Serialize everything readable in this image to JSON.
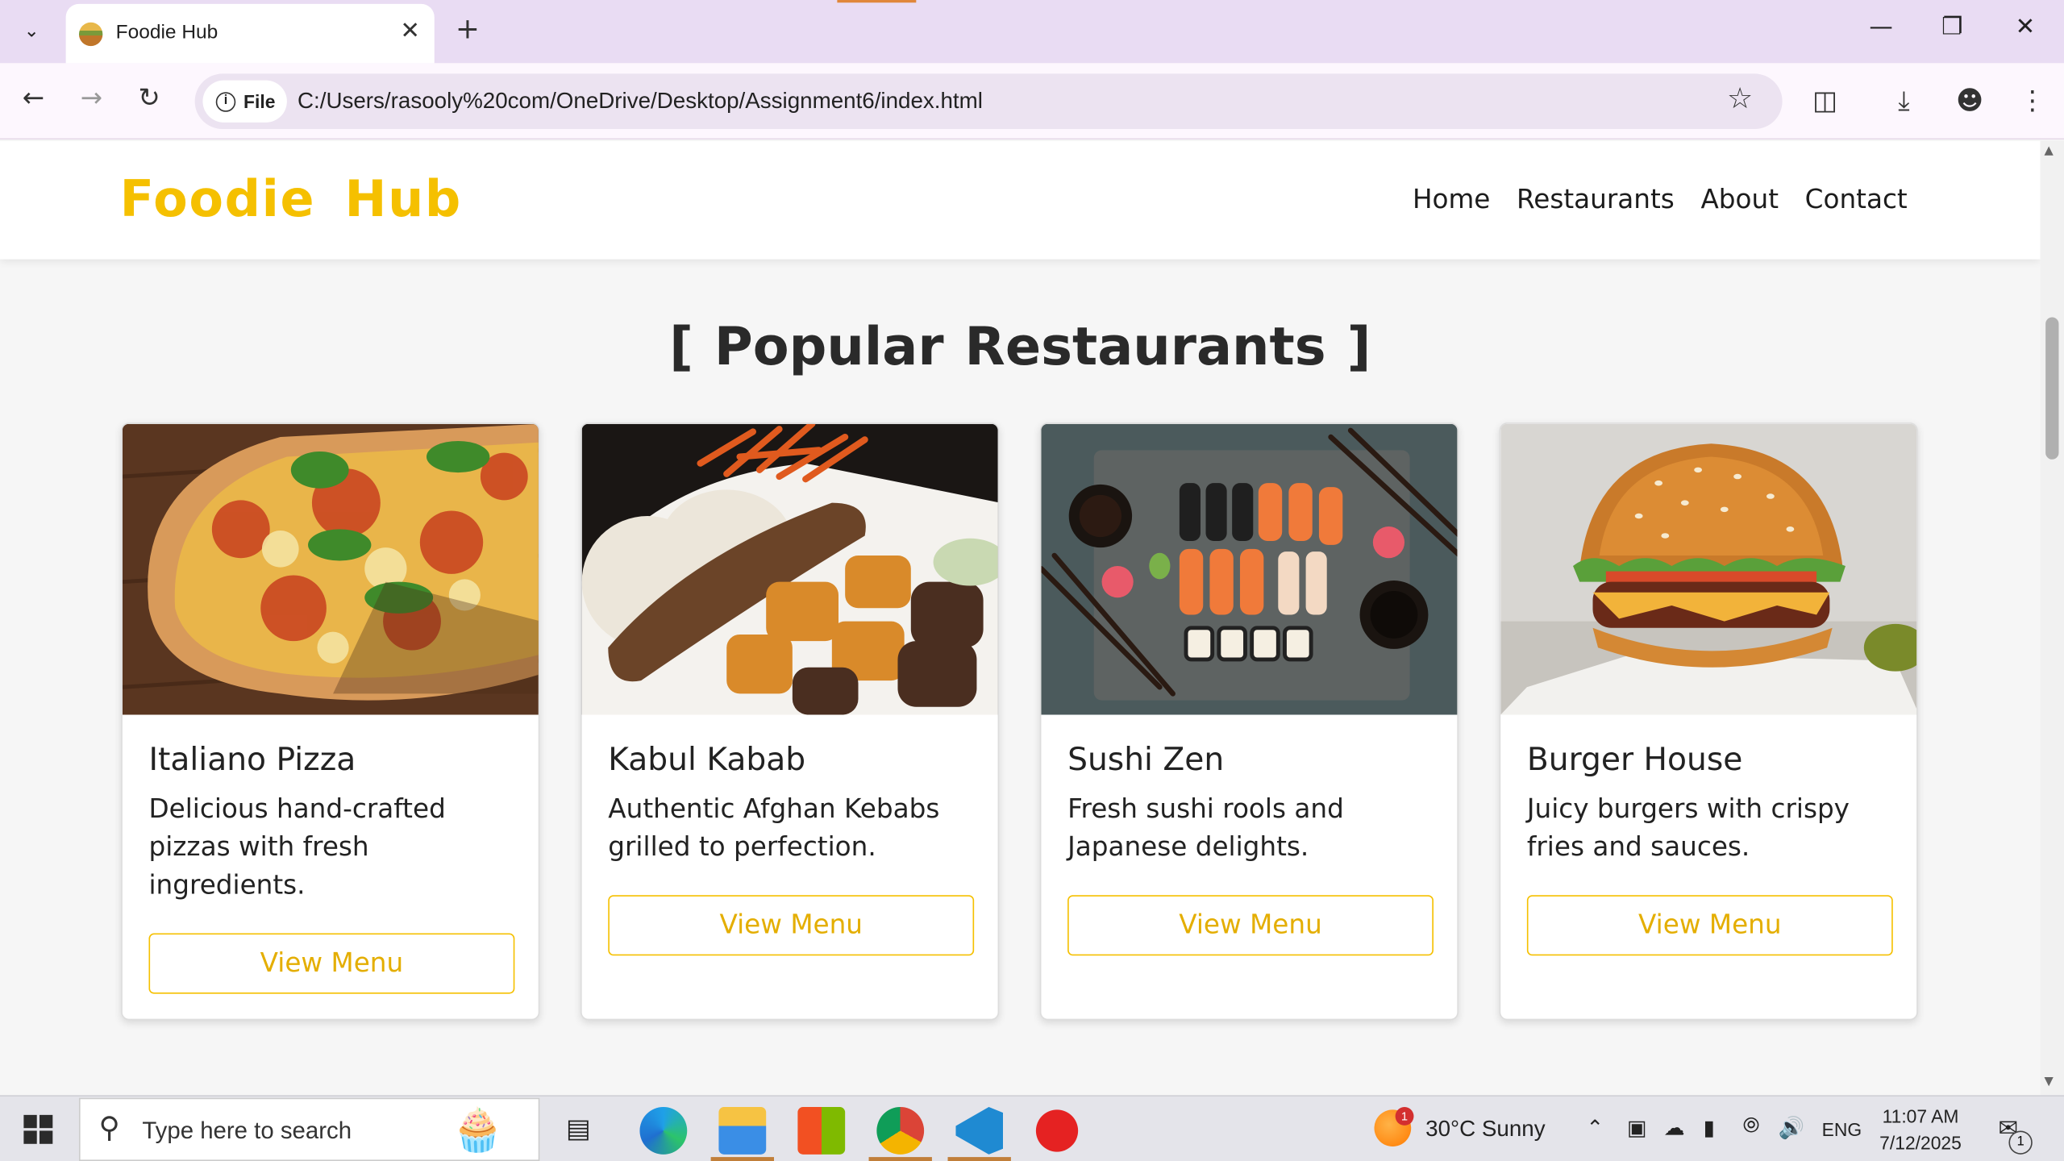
{
  "browser": {
    "tab_title": "Foodie Hub",
    "url_chip": "File",
    "url": "C:/Users/rasooly%20com/OneDrive/Desktop/Assignment6/index.html"
  },
  "site": {
    "logo": "Foodie Hub",
    "nav": [
      "Home",
      "Restaurants",
      "About",
      "Contact"
    ],
    "section_title": "[ Popular Restaurants ]",
    "cards": [
      {
        "name": "Italiano Pizza",
        "desc": "Delicious hand-crafted pizzas with fresh ingredients.",
        "button": "View Menu",
        "image": "pizza"
      },
      {
        "name": "Kabul Kabab",
        "desc": "Authentic Afghan Kebabs grilled to perfection.",
        "button": "View Menu",
        "image": "kebab"
      },
      {
        "name": "Sushi Zen",
        "desc": "Fresh sushi rools and Japanese delights.",
        "button": "View Menu",
        "image": "sushi"
      },
      {
        "name": "Burger House",
        "desc": "Juicy burgers with crispy fries and sauces.",
        "button": "View Menu",
        "image": "burger"
      }
    ],
    "colors": {
      "accent": "#f5c000"
    }
  },
  "taskbar": {
    "search_placeholder": "Type here to search",
    "weather": "30°C  Sunny",
    "weather_badge": "1",
    "lang": "ENG",
    "time": "11:07 AM",
    "date": "7/12/2025",
    "notification_count": "1"
  }
}
